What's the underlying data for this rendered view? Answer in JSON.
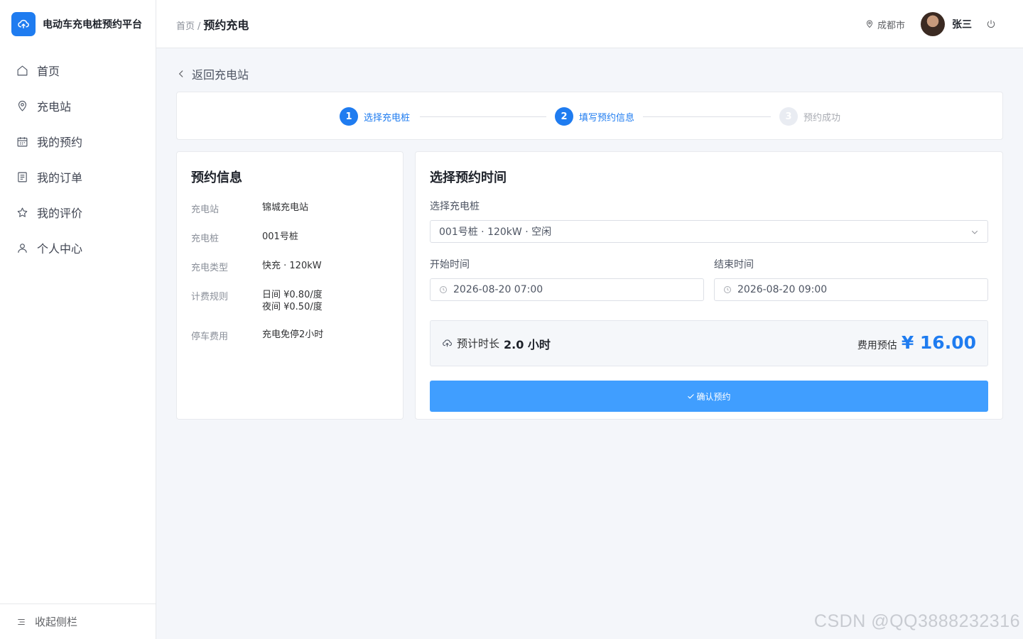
{
  "brand": {
    "title": "电动车充电桩预约平台"
  },
  "sidebar": {
    "items": [
      {
        "label": "首页",
        "icon": "home-icon"
      },
      {
        "label": "充电站",
        "icon": "location-icon"
      },
      {
        "label": "我的预约",
        "icon": "calendar-icon"
      },
      {
        "label": "我的订单",
        "icon": "document-icon"
      },
      {
        "label": "我的评价",
        "icon": "star-icon"
      },
      {
        "label": "个人中心",
        "icon": "user-icon"
      }
    ],
    "collapse_label": "收起侧栏"
  },
  "header": {
    "breadcrumb_home": "首页",
    "breadcrumb_sep": "/",
    "breadcrumb_current": "预约充电",
    "city": "成都市",
    "username": "张三"
  },
  "back": {
    "label": "返回充电站"
  },
  "steps": [
    {
      "number": "1",
      "label": "选择充电桩",
      "state": "done"
    },
    {
      "number": "2",
      "label": "填写预约信息",
      "state": "active"
    },
    {
      "number": "3",
      "label": "预约成功",
      "state": "pending"
    }
  ],
  "info": {
    "title": "预约信息",
    "rows": [
      {
        "key": "充电站",
        "value": "锦城充电站"
      },
      {
        "key": "充电桩",
        "value": "001号桩"
      },
      {
        "key": "充电类型",
        "value": "快充 · 120kW"
      },
      {
        "key": "计费规则",
        "value_day": "日间 ¥0.80/度",
        "value_night": "夜间 ¥0.50/度"
      },
      {
        "key": "停车费用",
        "value": "充电免停2小时"
      }
    ]
  },
  "form": {
    "title": "选择预约时间",
    "pile_label": "选择充电桩",
    "pile_value": "001号桩 · 120kW · 空闲",
    "start_label": "开始时间",
    "start_value": "2026-08-20 07:00",
    "end_label": "结束时间",
    "end_value": "2026-08-20 09:00",
    "estimate_label": "预计时长",
    "estimate_hours": "2.0 小时",
    "fee_label": "费用预估",
    "fee_amount": "¥ 16.00",
    "confirm_label": "确认预约"
  },
  "colors": {
    "primary": "#1f7cf0",
    "button": "#409eff"
  },
  "watermark": "CSDN @QQ3888232316"
}
